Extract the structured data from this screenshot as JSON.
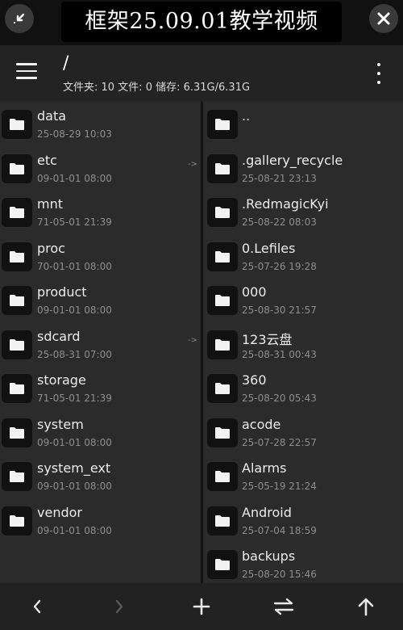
{
  "banner": {
    "text": "框架25.09.01教学视频"
  },
  "toolbar": {
    "path": "/",
    "stats": "文件夹: 10  文件: 0  储存: 6.31G/6.31G"
  },
  "left_pane": {
    "items": [
      {
        "name": "data",
        "date": "25-08-29 10:03",
        "arrow": ""
      },
      {
        "name": "etc",
        "date": "09-01-01 08:00",
        "arrow": "->"
      },
      {
        "name": "mnt",
        "date": "71-05-01 21:39",
        "arrow": ""
      },
      {
        "name": "proc",
        "date": "70-01-01 08:00",
        "arrow": ""
      },
      {
        "name": "product",
        "date": "09-01-01 08:00",
        "arrow": ""
      },
      {
        "name": "sdcard",
        "date": "25-08-31 07:00",
        "arrow": "->"
      },
      {
        "name": "storage",
        "date": "71-05-01 21:39",
        "arrow": ""
      },
      {
        "name": "system",
        "date": "09-01-01 08:00",
        "arrow": ""
      },
      {
        "name": "system_ext",
        "date": "09-01-01 08:00",
        "arrow": ""
      },
      {
        "name": "vendor",
        "date": "09-01-01 08:00",
        "arrow": ""
      }
    ]
  },
  "right_pane": {
    "items": [
      {
        "name": "..",
        "date": ""
      },
      {
        "name": ".gallery_recycle",
        "date": "25-08-21 23:13"
      },
      {
        "name": ".RedmagicKyi",
        "date": "25-08-22 08:03"
      },
      {
        "name": "0.Lefiles",
        "date": "25-07-26 19:28"
      },
      {
        "name": "000",
        "date": "25-08-30 21:57"
      },
      {
        "name": "123云盘",
        "date": "25-08-31 00:43"
      },
      {
        "name": "360",
        "date": "25-08-20 05:43"
      },
      {
        "name": "acode",
        "date": "25-07-28 22:57"
      },
      {
        "name": "Alarms",
        "date": "25-05-19 21:24"
      },
      {
        "name": "Android",
        "date": "25-07-04 18:59"
      },
      {
        "name": "backups",
        "date": "25-08-20 15:46"
      }
    ]
  },
  "icons": {
    "top_left": "shrink-arrows-icon",
    "top_right": "close-icon",
    "menu": "hamburger-menu-icon",
    "overflow": "more-vertical-icon",
    "folder": "folder-icon",
    "back": "chevron-left-icon",
    "forward": "chevron-right-icon",
    "add": "plus-icon",
    "swap": "swap-arrows-icon",
    "up": "arrow-up-icon"
  },
  "colors": {
    "background": "#2b2b2b",
    "toolbar": "#232323",
    "text": "#ececec",
    "muted": "#8e8e8e"
  }
}
